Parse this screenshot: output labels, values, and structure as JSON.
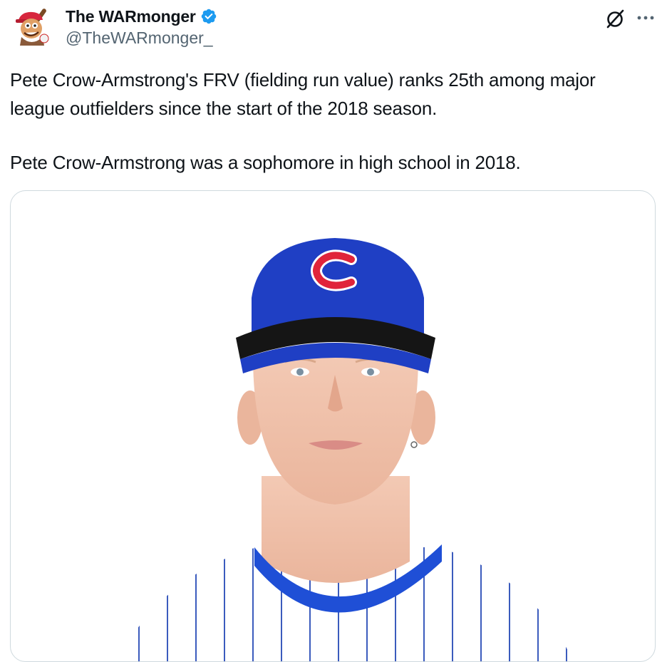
{
  "author": {
    "display_name": "The WARmonger",
    "handle": "@TheWARmonger_",
    "verified": true,
    "avatar_icon": "cartoon-baseball-mascot-avatar"
  },
  "header_icons": {
    "grok": "grok-icon",
    "more": "more-options-icon"
  },
  "tweet": {
    "paragraphs": [
      "Pete Crow-Armstrong's FRV (fielding run value) ranks 25th among major league outfielders since the start of the 2018 season.",
      "Pete Crow-Armstrong was a sophomore in high school in 2018."
    ]
  },
  "media": {
    "type": "photo",
    "description_icon": "baseball-player-headshot",
    "cap_logo_letter": "C"
  },
  "colors": {
    "verified_blue": "#1d9bf0",
    "text_primary": "#0f1419",
    "text_secondary": "#536471",
    "border": "#cfd9de",
    "cap_blue": "#1f3fc4",
    "cap_red": "#e0243a"
  }
}
